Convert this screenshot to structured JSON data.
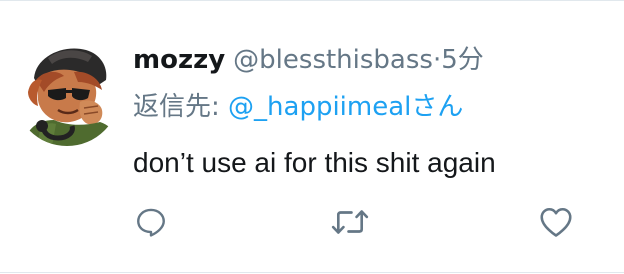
{
  "tweet": {
    "display_name": "mozzy",
    "handle": "@blessthisbass",
    "separator": "·",
    "time": "5分",
    "reply_prefix": "返信先:",
    "reply_to": "@_happiimeal",
    "reply_suffix": "さん",
    "text": "don’t use ai for this shit again"
  },
  "icons": {
    "reply": "reply-icon",
    "retweet": "retweet-icon",
    "like": "heart-icon",
    "avatar": "avatar-illustration"
  },
  "colors": {
    "accent": "#1da1f2",
    "secondary_text": "#657786",
    "primary_text": "#14171a"
  }
}
